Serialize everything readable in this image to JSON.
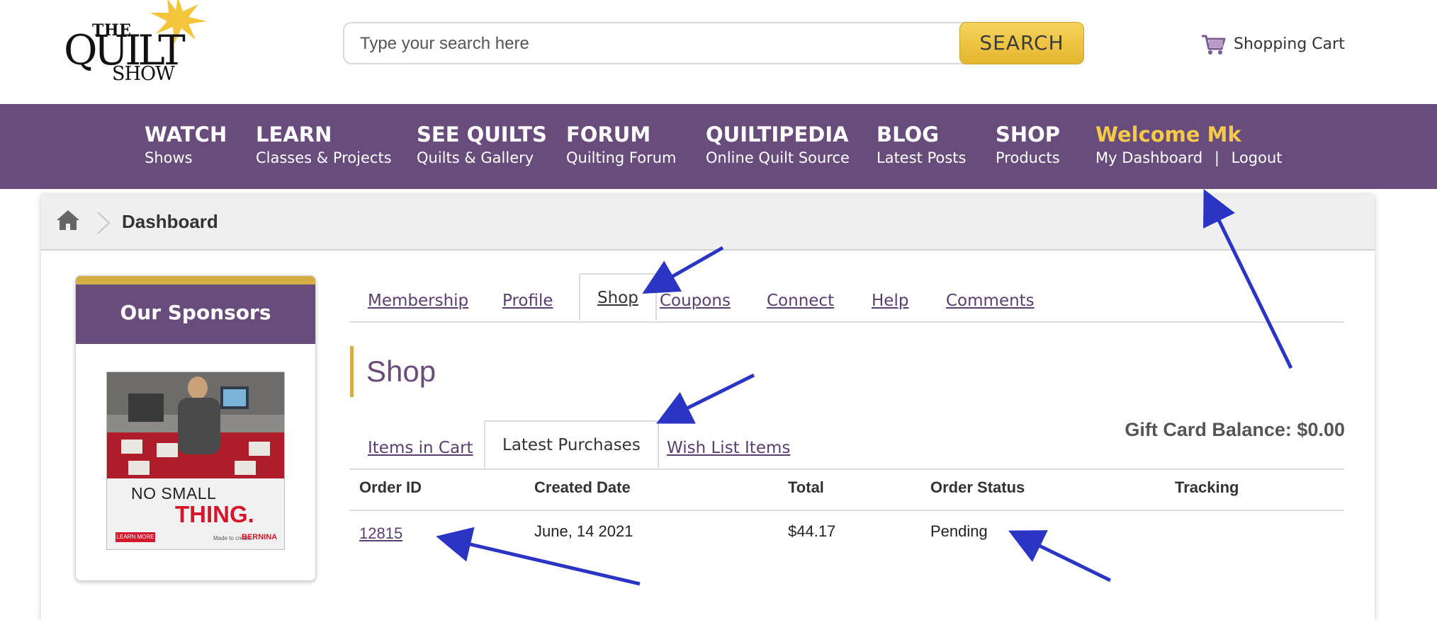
{
  "header": {
    "logo": {
      "the": "THE",
      "quilt": "QUILT",
      "show": "SHOW"
    },
    "search": {
      "placeholder": "Type your search here",
      "value": "",
      "button_label": "SEARCH"
    },
    "cart": {
      "label": "Shopping Cart",
      "icon": "shopping-cart-icon"
    }
  },
  "nav": {
    "items": [
      {
        "title": "WATCH",
        "subtitle": "Shows"
      },
      {
        "title": "LEARN",
        "subtitle": "Classes & Projects"
      },
      {
        "title": "SEE QUILTS",
        "subtitle": "Quilts & Gallery"
      },
      {
        "title": "FORUM",
        "subtitle": "Quilting Forum"
      },
      {
        "title": "QUILTIPEDIA",
        "subtitle": "Online Quilt Source"
      },
      {
        "title": "BLOG",
        "subtitle": "Latest Posts"
      },
      {
        "title": "SHOP",
        "subtitle": "Products"
      }
    ],
    "welcome": {
      "title": "Welcome Mk",
      "dashboard": "My Dashboard",
      "separator": "|",
      "logout": "Logout"
    }
  },
  "breadcrumb": {
    "home_icon": "home-icon",
    "current": "Dashboard"
  },
  "sponsors": {
    "title": "Our Sponsors",
    "ad": {
      "line1": "NO SMALL",
      "line2": "THING.",
      "button": "LEARN MORE",
      "byline": "Made to create",
      "brand": "BERNINA"
    }
  },
  "tabs": {
    "items": [
      "Membership",
      "Profile",
      "Shop",
      "Coupons",
      "Connect",
      "Help",
      "Comments"
    ],
    "active": "Shop"
  },
  "shop": {
    "title": "Shop",
    "subtabs": [
      "Items in Cart",
      "Latest Purchases",
      "Wish List Items"
    ],
    "active_subtab": "Latest Purchases",
    "gift_card": "Gift Card Balance: $0.00",
    "columns": [
      "Order ID",
      "Created Date",
      "Total",
      "Order Status",
      "Tracking"
    ],
    "orders": [
      {
        "order_id": "12815",
        "created": "June, 14 2021",
        "total": "$44.17",
        "status": "Pending",
        "tracking": ""
      }
    ]
  },
  "colors": {
    "brand_purple": "#684c7c",
    "accent_gold": "#d4ad45",
    "welcome_yellow": "#f7c948",
    "annotation_arrow": "#2a35c4"
  }
}
